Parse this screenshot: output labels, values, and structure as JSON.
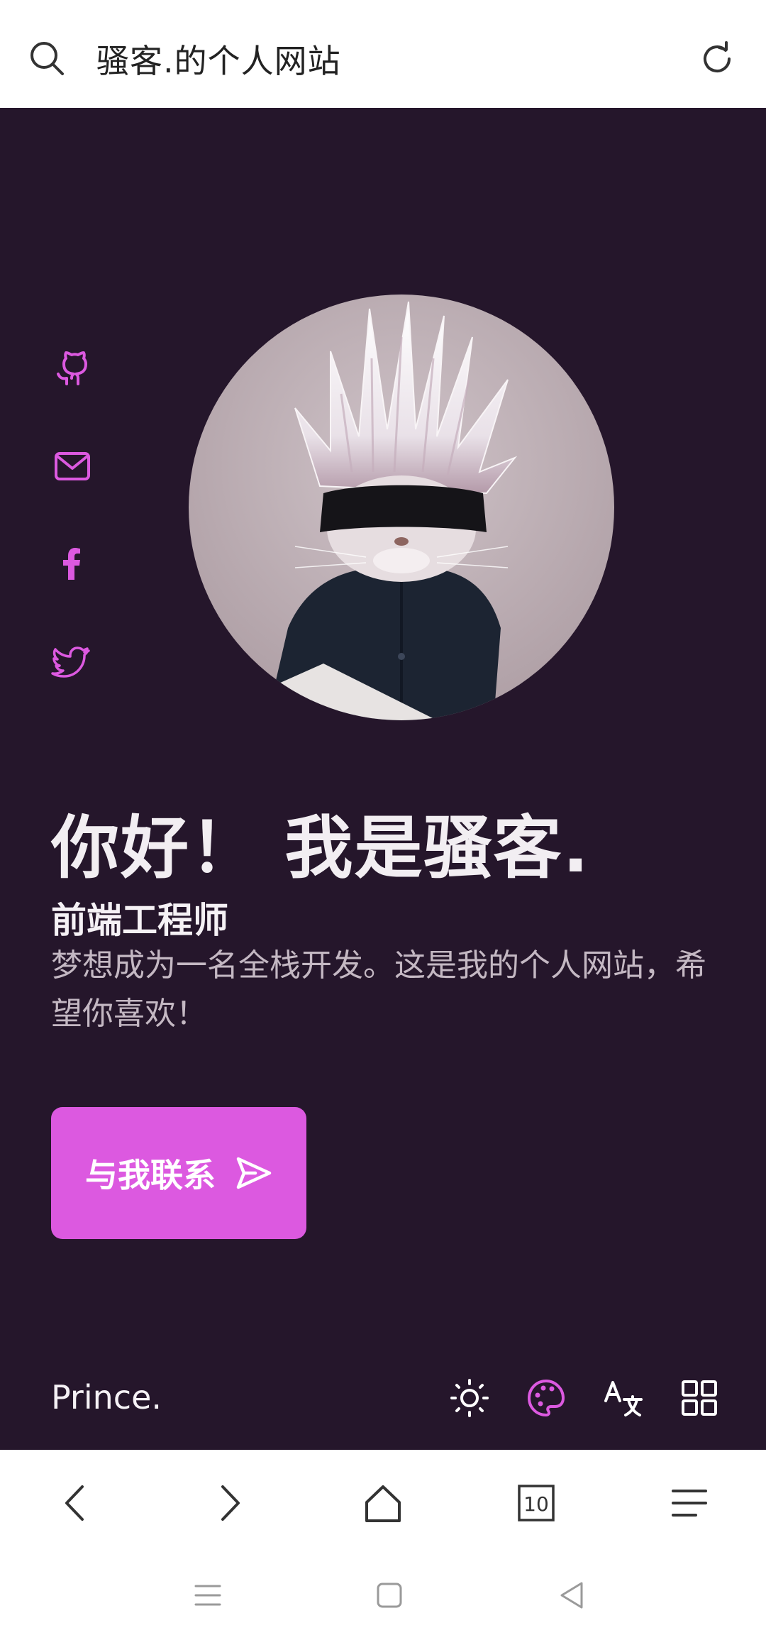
{
  "browser": {
    "title": "骚客.的个人网站",
    "tab_count": "10",
    "icons": {
      "search": "search-icon",
      "reload": "reload-icon",
      "back": "back-icon",
      "forward": "forward-icon",
      "home": "home-icon",
      "tabs": "tabs-icon",
      "menu": "menu-icon"
    }
  },
  "hero": {
    "greeting": "你好！ 我是骚客.",
    "role": "前端工程师",
    "description": "梦想成为一名全栈开发。这是我的个人网站，希望你喜欢！",
    "contact_button": "与我联系",
    "social_icons": [
      "github-icon",
      "mail-icon",
      "facebook-icon",
      "twitter-icon"
    ],
    "avatar": "avatar"
  },
  "footer": {
    "brand": "Prince.",
    "tools": [
      "sun-icon",
      "palette-icon",
      "translate-icon",
      "grid-icon"
    ]
  },
  "colors": {
    "background": "#25162b",
    "accent": "#dc59e0",
    "text": "#f2eef2",
    "muted": "#c4b8c3"
  }
}
